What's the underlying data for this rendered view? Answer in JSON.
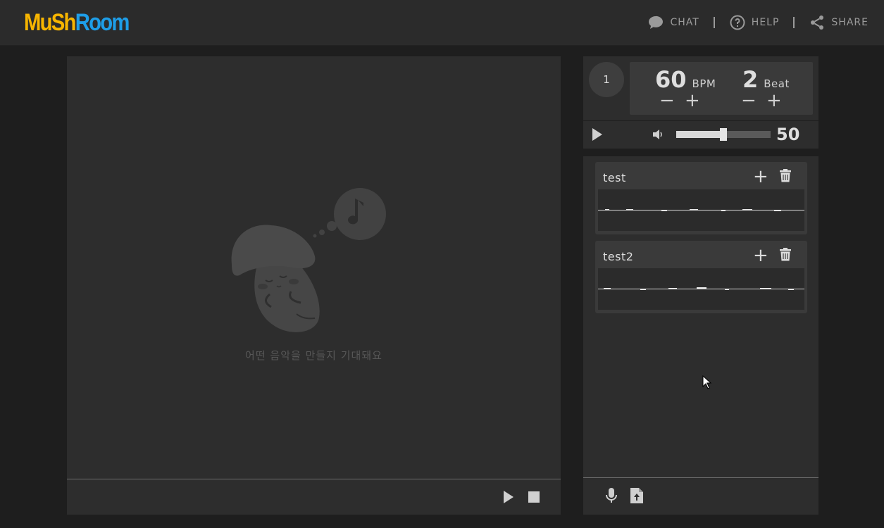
{
  "header": {
    "logo_part1": "MuSh",
    "logo_part2": "Room",
    "nav": [
      {
        "label": "CHAT",
        "icon": "chat-bubble-icon"
      },
      {
        "label": "HELP",
        "icon": "help-circle-icon"
      },
      {
        "label": "SHARE",
        "icon": "share-icon"
      }
    ]
  },
  "stage": {
    "empty_message": "어떤 음악을 만들지 기대돼요",
    "controls": [
      "play-icon",
      "stop-icon"
    ]
  },
  "metronome": {
    "count": "1",
    "bpm_value": "60",
    "bpm_unit": "BPM",
    "beat_value": "2",
    "beat_unit": "Beat",
    "minus": "−",
    "plus": "+",
    "volume": 50,
    "volume_label": "50"
  },
  "tracks": [
    {
      "name": "test",
      "add_label": "+"
    },
    {
      "name": "test2",
      "add_label": "+"
    }
  ],
  "bottom_controls": [
    "microphone-icon",
    "file-upload-icon"
  ],
  "colors": {
    "logo_yellow": "#f7b500",
    "logo_blue": "#1e9ee8",
    "panel": "#2d2d2d",
    "background": "#1e1e1e"
  }
}
